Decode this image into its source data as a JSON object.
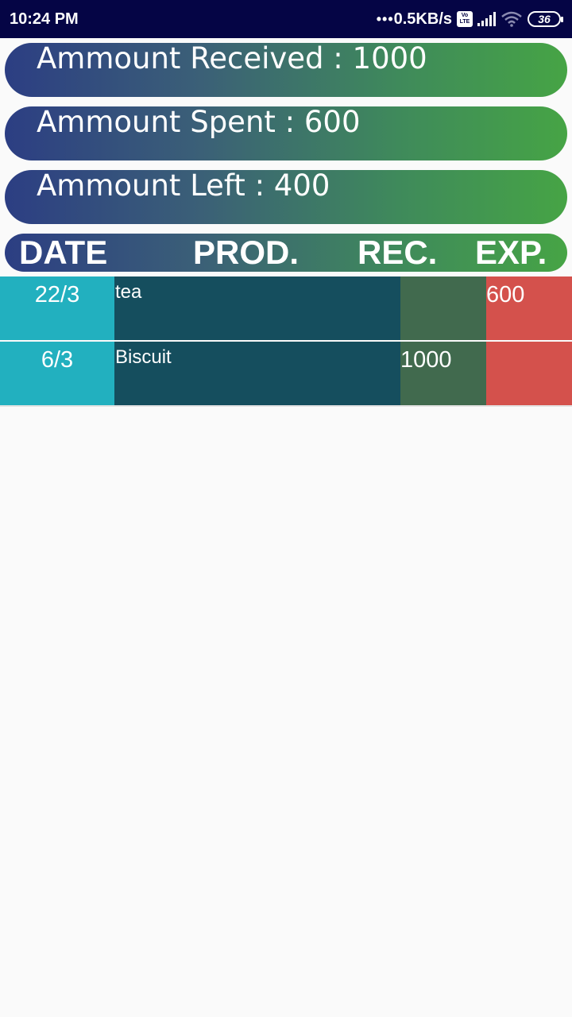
{
  "status_bar": {
    "time": "10:24 PM",
    "network_dots": "•••",
    "network_speed": "0.5KB/s",
    "volte_top": "Vo",
    "volte_bottom": "LTE",
    "battery": "36"
  },
  "summary": {
    "received": "Ammount Received : 1000",
    "spent": "Ammount Spent : 600",
    "left": "Ammount Left : 400"
  },
  "table_header": {
    "date": "DATE",
    "product": "PROD.",
    "received": "REC.",
    "expense": "EXP."
  },
  "rows": [
    {
      "date": "22/3",
      "product": "tea",
      "received": "",
      "expense": "600"
    },
    {
      "date": "6/3",
      "product": "Biscuit",
      "received": "1000",
      "expense": ""
    }
  ],
  "colors": {
    "status_bar": "#050545",
    "gradient_start": "#2c3e83",
    "gradient_end": "#46a445",
    "date_col": "#22b0bf",
    "product_col": "#154e5e",
    "received_col": "#416a4e",
    "expense_col": "#d4514c"
  }
}
